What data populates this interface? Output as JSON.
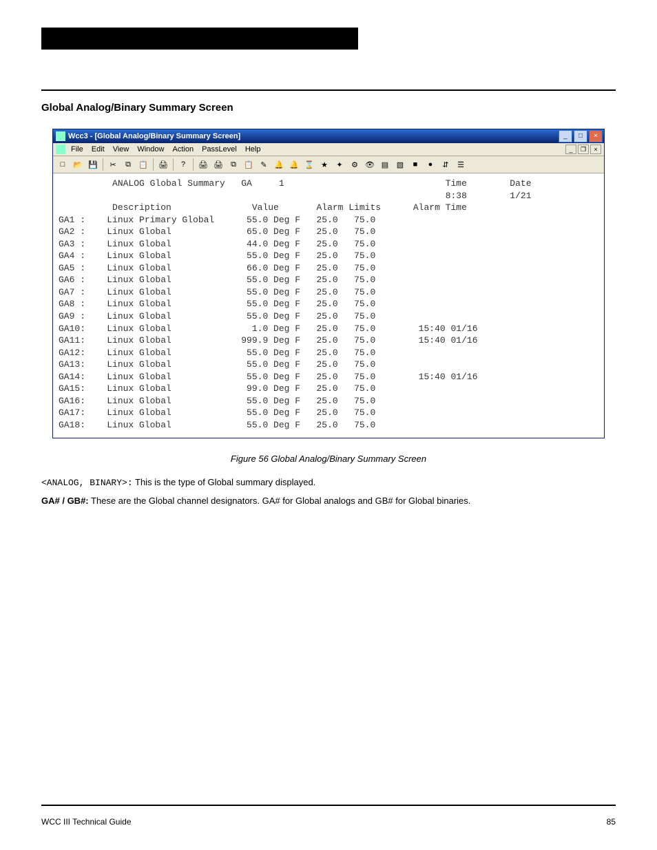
{
  "header": {
    "blackbar": true
  },
  "section": {
    "title": "Global Analog/Binary Summary Screen"
  },
  "app": {
    "title": "Wcc3 - [Global Analog/Binary Summary Screen]",
    "systemmenu_tip": "system-menu",
    "menus": [
      "File",
      "Edit",
      "View",
      "Window",
      "Action",
      "PassLevel",
      "Help"
    ],
    "mdi_tip": {
      "min": "_",
      "restore": "❐",
      "close": "×"
    },
    "winctl_tip": {
      "min": "_",
      "max": "□",
      "close": "×"
    }
  },
  "toolbar_icons": [
    "new",
    "open",
    "save",
    "cut",
    "copy",
    "paste",
    "print",
    "help",
    "print-all",
    "print-sc",
    "copy-sc",
    "paste-sc",
    "edit",
    "bell",
    "bell2",
    "hourglass",
    "star",
    "wand",
    "gear",
    "eye",
    "doc",
    "chart",
    "stop",
    "rec",
    "net",
    "tree"
  ],
  "screen": {
    "title_left": "ANALOG Global Summary",
    "title_code": "GA",
    "title_num": "1",
    "time_lbl": "Time",
    "time_val": "8:38",
    "date_lbl": "Date",
    "date_val": "1/21",
    "col_desc": "Description",
    "col_value": "Value",
    "col_limits": "Alarm Limits",
    "col_alarm": "Alarm Time",
    "rows": [
      {
        "id": "GA1 :",
        "desc": "Linux Primary Global",
        "val": "55.0",
        "unit": "Deg F",
        "lo": "25.0",
        "hi": "75.0",
        "atime": ""
      },
      {
        "id": "GA2 :",
        "desc": "Linux Global",
        "val": "65.0",
        "unit": "Deg F",
        "lo": "25.0",
        "hi": "75.0",
        "atime": ""
      },
      {
        "id": "GA3 :",
        "desc": "Linux Global",
        "val": "44.0",
        "unit": "Deg F",
        "lo": "25.0",
        "hi": "75.0",
        "atime": ""
      },
      {
        "id": "GA4 :",
        "desc": "Linux Global",
        "val": "55.0",
        "unit": "Deg F",
        "lo": "25.0",
        "hi": "75.0",
        "atime": ""
      },
      {
        "id": "GA5 :",
        "desc": "Linux Global",
        "val": "66.0",
        "unit": "Deg F",
        "lo": "25.0",
        "hi": "75.0",
        "atime": ""
      },
      {
        "id": "GA6 :",
        "desc": "Linux Global",
        "val": "55.0",
        "unit": "Deg F",
        "lo": "25.0",
        "hi": "75.0",
        "atime": ""
      },
      {
        "id": "GA7 :",
        "desc": "Linux Global",
        "val": "55.0",
        "unit": "Deg F",
        "lo": "25.0",
        "hi": "75.0",
        "atime": ""
      },
      {
        "id": "GA8 :",
        "desc": "Linux Global",
        "val": "55.0",
        "unit": "Deg F",
        "lo": "25.0",
        "hi": "75.0",
        "atime": ""
      },
      {
        "id": "GA9 :",
        "desc": "Linux Global",
        "val": "55.0",
        "unit": "Deg F",
        "lo": "25.0",
        "hi": "75.0",
        "atime": ""
      },
      {
        "id": "GA10:",
        "desc": "Linux Global",
        "val": "1.0",
        "unit": "Deg F",
        "lo": "25.0",
        "hi": "75.0",
        "atime": "15:40 01/16"
      },
      {
        "id": "GA11:",
        "desc": "Linux Global",
        "val": "999.9",
        "unit": "Deg F",
        "lo": "25.0",
        "hi": "75.0",
        "atime": "15:40 01/16"
      },
      {
        "id": "GA12:",
        "desc": "Linux Global",
        "val": "55.0",
        "unit": "Deg F",
        "lo": "25.0",
        "hi": "75.0",
        "atime": ""
      },
      {
        "id": "GA13:",
        "desc": "Linux Global",
        "val": "55.0",
        "unit": "Deg F",
        "lo": "25.0",
        "hi": "75.0",
        "atime": ""
      },
      {
        "id": "GA14:",
        "desc": "Linux Global",
        "val": "55.0",
        "unit": "Deg F",
        "lo": "25.0",
        "hi": "75.0",
        "atime": "15:40 01/16"
      },
      {
        "id": "GA15:",
        "desc": "Linux Global",
        "val": "99.0",
        "unit": "Deg F",
        "lo": "25.0",
        "hi": "75.0",
        "atime": ""
      },
      {
        "id": "GA16:",
        "desc": "Linux Global",
        "val": "55.0",
        "unit": "Deg F",
        "lo": "25.0",
        "hi": "75.0",
        "atime": ""
      },
      {
        "id": "GA17:",
        "desc": "Linux Global",
        "val": "55.0",
        "unit": "Deg F",
        "lo": "25.0",
        "hi": "75.0",
        "atime": ""
      },
      {
        "id": "GA18:",
        "desc": "Linux Global",
        "val": "55.0",
        "unit": "Deg F",
        "lo": "25.0",
        "hi": "75.0",
        "atime": ""
      }
    ]
  },
  "caption": "Figure 56  Global Analog/Binary Summary Screen",
  "params": {
    "p1_label": "<ANALOG, BINARY>:",
    "p1_text": " This is the type of Global summary displayed.",
    "p2_label": "GA# / GB#:",
    "p2_text": " These are the Global channel designators.  GA# for Global analogs and GB# for Global binaries."
  },
  "footer": {
    "left": "WCC III Technical Guide",
    "right": "85"
  }
}
